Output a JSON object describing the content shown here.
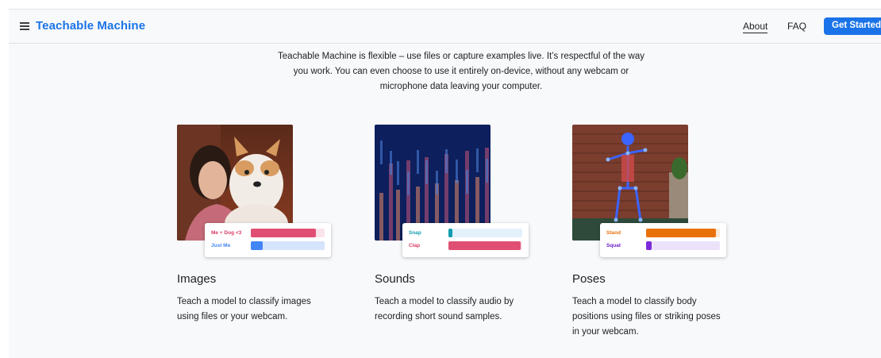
{
  "header": {
    "brand": "Teachable Machine",
    "nav": {
      "about": "About",
      "faq": "FAQ",
      "cta": "Get Started"
    }
  },
  "intro": {
    "line1": "Teachable Machine is flexible – use files or capture examples live. It’s respectful of the way",
    "line2": "you work. You can even choose to use it entirely on-device, without any webcam or",
    "line3": "microphone data leaving your computer."
  },
  "cards": [
    {
      "title": "Images",
      "desc1": "Teach a model to classify images",
      "desc2": "using files or your webcam.",
      "classes": [
        {
          "label": "Me + Dog <3",
          "level": 0.88,
          "color": "#e04f73",
          "track": "#fbe3ea",
          "labelColor": "#d93b64"
        },
        {
          "label": "Just Me",
          "level": 0.16,
          "color": "#4285f4",
          "track": "#d6e4fc",
          "labelColor": "#4285f4"
        }
      ]
    },
    {
      "title": "Sounds",
      "desc1": "Teach a model to classify audio by",
      "desc2": "recording short sound samples.",
      "classes": [
        {
          "label": "Snap",
          "level": 0.05,
          "color": "#129eaf",
          "track": "#e3f1fb",
          "labelColor": "#129eaf"
        },
        {
          "label": "Clap",
          "level": 0.98,
          "color": "#e04f73",
          "track": "#fbe3ea",
          "labelColor": "#d93b64"
        }
      ]
    },
    {
      "title": "Poses",
      "desc1": "Teach a model to classify body",
      "desc2": "positions using files or striking poses",
      "desc3": "in your webcam.",
      "classes": [
        {
          "label": "Stand",
          "level": 0.95,
          "color": "#e8710a",
          "track": "#fde9d7",
          "labelColor": "#e8710a"
        },
        {
          "label": "Squat",
          "level": 0.08,
          "color": "#7b2bd9",
          "track": "#ece3fb",
          "labelColor": "#6a1fd0"
        }
      ]
    }
  ]
}
